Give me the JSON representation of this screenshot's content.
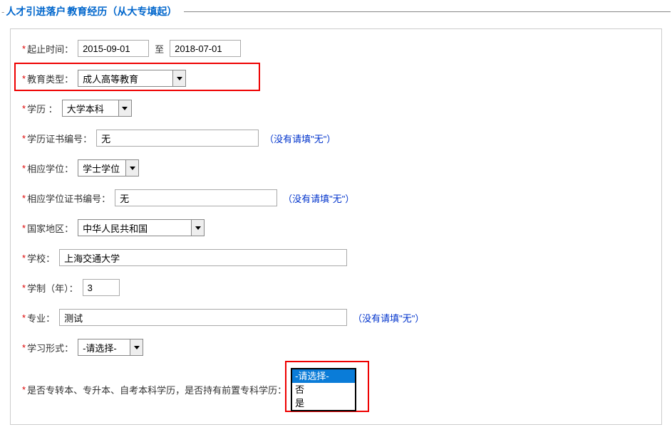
{
  "header": {
    "dash": "-",
    "title1": "人才引进落户",
    "title2": "教育经历（从大专填起）"
  },
  "labels": {
    "date_range": "起止时间：",
    "to": "至",
    "edu_type": "教育类型：",
    "degree": "学历 ：",
    "degree_cert_no": "学历证书编号：",
    "xuewei": "相应学位：",
    "xuewei_cert_no": "相应学位证书编号：",
    "country": "国家地区：",
    "school": "学校：",
    "study_years": "学制（年）：",
    "major": "专业：",
    "study_form": "学习形式：",
    "prior_zhuanke": "是否专转本、专升本、自考本科学历，是否持有前置专科学历：",
    "hint_none": "（没有请填\"无\"）"
  },
  "values": {
    "start_date": "2015-09-01",
    "end_date": "2018-07-01",
    "edu_type": "成人高等教育",
    "degree": "大学本科",
    "degree_cert_no": "无",
    "xuewei": "学士学位",
    "xuewei_cert_no": "无",
    "country": "中华人民共和国",
    "school": "上海交通大学",
    "study_years": "3",
    "major": "测试",
    "study_form": "-请选择-"
  },
  "dropdown": {
    "options": [
      "-请选择-",
      "否",
      "是"
    ],
    "selected_index": 0
  }
}
